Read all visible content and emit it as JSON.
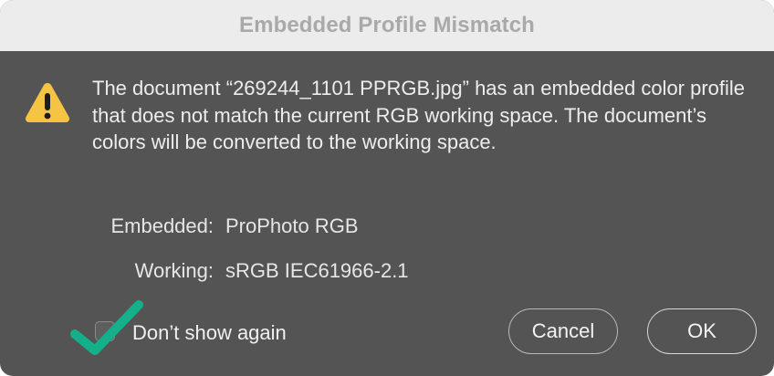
{
  "dialog": {
    "title": "Embedded Profile Mismatch",
    "message": "The document “269244_1101 PPRGB.jpg” has an embedded color profile that does not match the current RGB working space.  The document’s colors will be converted to the working space.",
    "embedded_label": "Embedded:",
    "embedded_value": "ProPhoto RGB",
    "working_label": "Working:",
    "working_value": "sRGB IEC61966-2.1",
    "checkbox_label": "Don’t show again",
    "checkbox_checked": false,
    "cancel_label": "Cancel",
    "ok_label": "OK"
  },
  "icons": {
    "warning": "warning-triangle-icon",
    "annotation": "green-checkmark-icon"
  },
  "colors": {
    "titlebar_bg": "#ececec",
    "title_text": "#a9a9a9",
    "dialog_bg": "#545454",
    "warning_yellow": "#f6c443",
    "annotation_green": "#14b08a"
  }
}
